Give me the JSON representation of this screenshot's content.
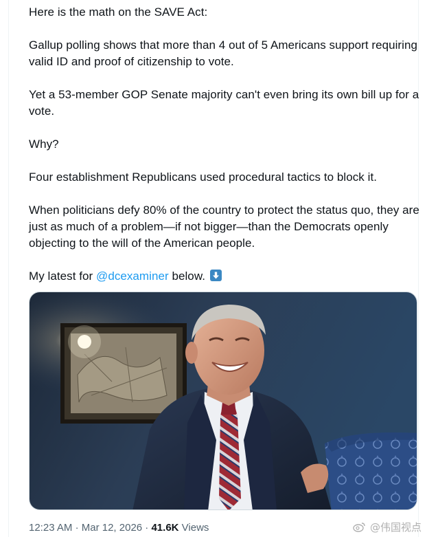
{
  "tweet": {
    "paragraphs": [
      "Here is the math on the SAVE Act:",
      "Gallup polling shows that more than 4 out of 5 Americans support requiring valid ID and proof of citizenship to vote.",
      "Yet a 53-member GOP Senate majority can't even bring its own bill up for a vote.",
      "Why?",
      "Four establishment Republicans used procedural tactics to block it.",
      "When politicians defy 80% of the country to protect the status quo, they are just as much of a problem—if not bigger—than the Democrats openly objecting to the will of the American people."
    ],
    "last_line_prefix": "My latest for ",
    "mention": "@dcexaminer",
    "last_line_suffix": " below.",
    "emoji": "down-arrow-emoji"
  },
  "meta": {
    "time": "12:23 AM",
    "separator": "·",
    "date": "Mar 12, 2026",
    "views_count": "41.6K",
    "views_label": "Views"
  },
  "watermark": {
    "text": "@伟国视点",
    "icon": "weibo-icon"
  },
  "colors": {
    "mention": "#1d9bf0",
    "meta_text": "#536471",
    "text": "#0f1419"
  }
}
